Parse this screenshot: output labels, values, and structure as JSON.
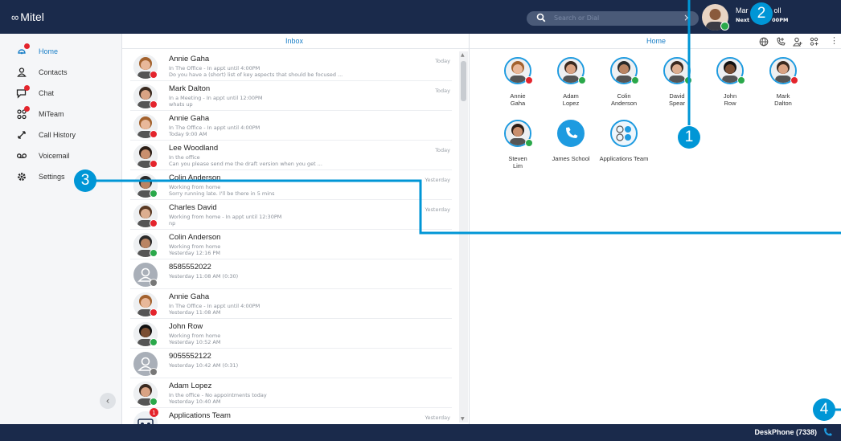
{
  "app": {
    "logo_mark": "∞",
    "logo_text": "Mitel"
  },
  "search": {
    "placeholder": "Search or Dial",
    "clear": "×"
  },
  "user": {
    "name": "Mar",
    "name_tail": "oll",
    "status": "Next",
    "status_tail": "00PM"
  },
  "callouts": [
    "1",
    "2",
    "3",
    "4"
  ],
  "sidebar": {
    "items": [
      {
        "label": "Home",
        "icon": "home-icon"
      },
      {
        "label": "Contacts",
        "icon": "contacts-icon"
      },
      {
        "label": "Chat",
        "icon": "chat-icon"
      },
      {
        "label": "MiTeam",
        "icon": "miteam-icon"
      },
      {
        "label": "Call History",
        "icon": "call-history-icon"
      },
      {
        "label": "Voicemail",
        "icon": "voicemail-icon"
      },
      {
        "label": "Settings",
        "icon": "settings-icon"
      }
    ],
    "collapse": "‹"
  },
  "inbox": {
    "title": "Inbox",
    "rows": [
      {
        "name": "Annie Gaha",
        "line1": "In The Office - In appt until 4:00PM",
        "line2": "Do you have a (short) list of key aspects that should be focused ...",
        "time": "Today"
      },
      {
        "name": "Mark Dalton",
        "line1": "In a Meeting - In appt until 12:00PM",
        "line2": "whats up",
        "time": "Today"
      },
      {
        "name": "Annie Gaha",
        "line1": "In The Office - In appt until 4:00PM",
        "line2": "Today 9:00 AM",
        "time": ""
      },
      {
        "name": "Lee Woodland",
        "line1": "In the office",
        "line2": "Can you please send me the draft version when you get ...",
        "time": "Today"
      },
      {
        "name": "Colin Anderson",
        "line1": "Working from home",
        "line2": "Sorry running late. I'll be there in 5 mins",
        "time": "Yesterday"
      },
      {
        "name": "Charles David",
        "line1": "Working from home - In appt until 12:30PM",
        "line2": "np",
        "time": "Yesterday"
      },
      {
        "name": "Colin Anderson",
        "line1": "Working from home",
        "line2": "Yesterday 12:16 PM",
        "time": ""
      },
      {
        "name": "8585552022",
        "line1": "Yesterday 11:08 AM (0:30)",
        "line2": "",
        "time": ""
      },
      {
        "name": "Annie Gaha",
        "line1": "In The Office - In appt until 4:00PM",
        "line2": "Yesterday 11:08 AM",
        "time": ""
      },
      {
        "name": "John Row",
        "line1": "Working from home",
        "line2": "Yesterday 10:52 AM",
        "time": ""
      },
      {
        "name": "9055552122",
        "line1": "Yesterday 10:42 AM (0:31)",
        "line2": "",
        "time": ""
      },
      {
        "name": "Adam Lopez",
        "line1": "In the office - No appointments today",
        "line2": "Yesterday 10:40 AM",
        "time": ""
      },
      {
        "name": "Applications Team",
        "line1": "",
        "line2": "",
        "time": "Yesterday",
        "badge": "1"
      }
    ]
  },
  "home": {
    "title": "Home",
    "toolbar": [
      "globe-icon",
      "add-call-icon",
      "add-contact-icon",
      "add-group-icon",
      "more-icon"
    ],
    "more_label": "⋮",
    "favorites": [
      {
        "line1": "Annie",
        "line2": "Gaha"
      },
      {
        "line1": "Adam",
        "line2": "Lopez"
      },
      {
        "line1": "Colin",
        "line2": "Anderson"
      },
      {
        "line1": "David",
        "line2": "Spear"
      },
      {
        "line1": "John",
        "line2": "Row"
      },
      {
        "line1": "Mark",
        "line2": "Dalton"
      },
      {
        "line1": "Steven",
        "line2": "Lim"
      },
      {
        "line1": "James School",
        "line2": ""
      },
      {
        "line1": "Applications Team",
        "line2": ""
      }
    ]
  },
  "statusbar": {
    "device": "DeskPhone (7338)"
  },
  "colors": {
    "navy": "#1a2a4b",
    "accent": "#1a7fc7",
    "callout": "#0096d6",
    "busy": "#e4242c",
    "available": "#2aa84a"
  }
}
